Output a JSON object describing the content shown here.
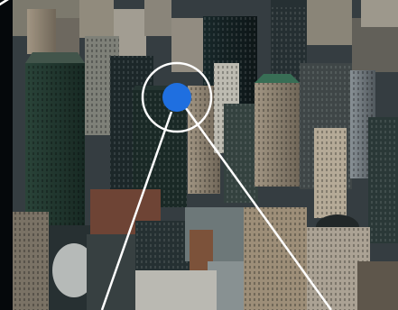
{
  "scene": {
    "subject": "aerial-city-skyline",
    "marker_icon": "location-dot-icon",
    "marker_color": "#1f6fe0",
    "ring_color": "#ffffff",
    "connector_color": "#ffffff"
  }
}
